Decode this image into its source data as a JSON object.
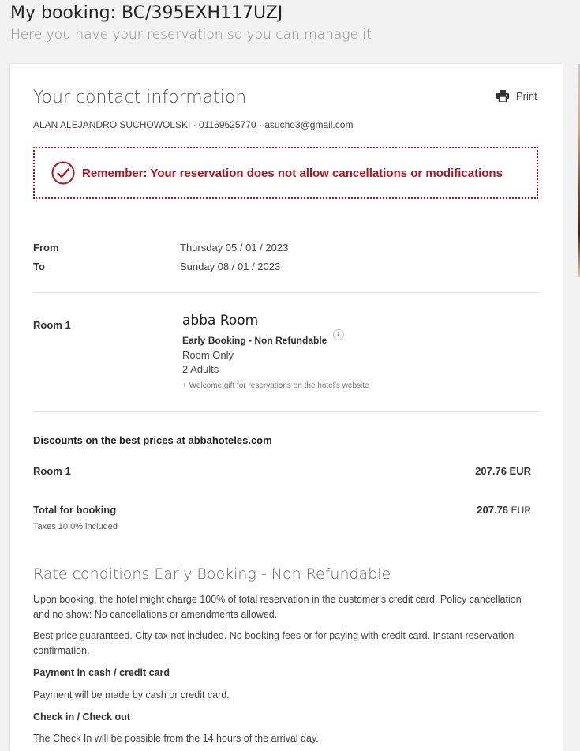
{
  "header": {
    "title": "My booking: BC/395EXH117UZJ",
    "subtitle": "Here you have your reservation so you can manage it"
  },
  "contact": {
    "section_title": "Your contact information",
    "print_label": "Print",
    "line": "ALAN ALEJANDRO SUCHOWOLSKI · 01169625770 · asucho3@gmail.com"
  },
  "alert": {
    "text": "Remember: Your reservation does not allow cancellations or modifications",
    "color": "#b5121b"
  },
  "dates": {
    "from_label": "From",
    "from_value": "Thursday 05 / 01 / 2023",
    "to_label": "To",
    "to_value": "Sunday 08 / 01 / 2023"
  },
  "room": {
    "label": "Room 1",
    "name": "abba Room",
    "rate": "Early Booking - Non Refundable",
    "board": "Room Only",
    "guests": "2 Adults",
    "gift": "+ Welcome gift for reservations on the hotel's website"
  },
  "pricing": {
    "discount_title": "Discounts on the best prices at abbahoteles.com",
    "room_label": "Room 1",
    "room_amount": "207.76 EUR",
    "total_label": "Total for booking",
    "total_amount": "207.76",
    "total_currency": "EUR",
    "taxes": "Taxes  10.0%  included"
  },
  "conditions": {
    "title": "Rate conditions  Early Booking - Non Refundable",
    "p1": "Upon booking, the hotel might charge 100% of total reservation in the customer's credit card. Policy cancellation and no show: No cancellations or amendments allowed.",
    "p2": "Best price guaranteed. City tax not included. No booking fees or for paying with credit card. Instant reservation confirmation.",
    "payment_title": "Payment in cash / credit card",
    "payment_text": "Payment will be made by cash or credit card.",
    "checkin_title": "Check in / Check out",
    "checkin_text": "The Check In will be possible from the 14 hours of the arrival day."
  }
}
